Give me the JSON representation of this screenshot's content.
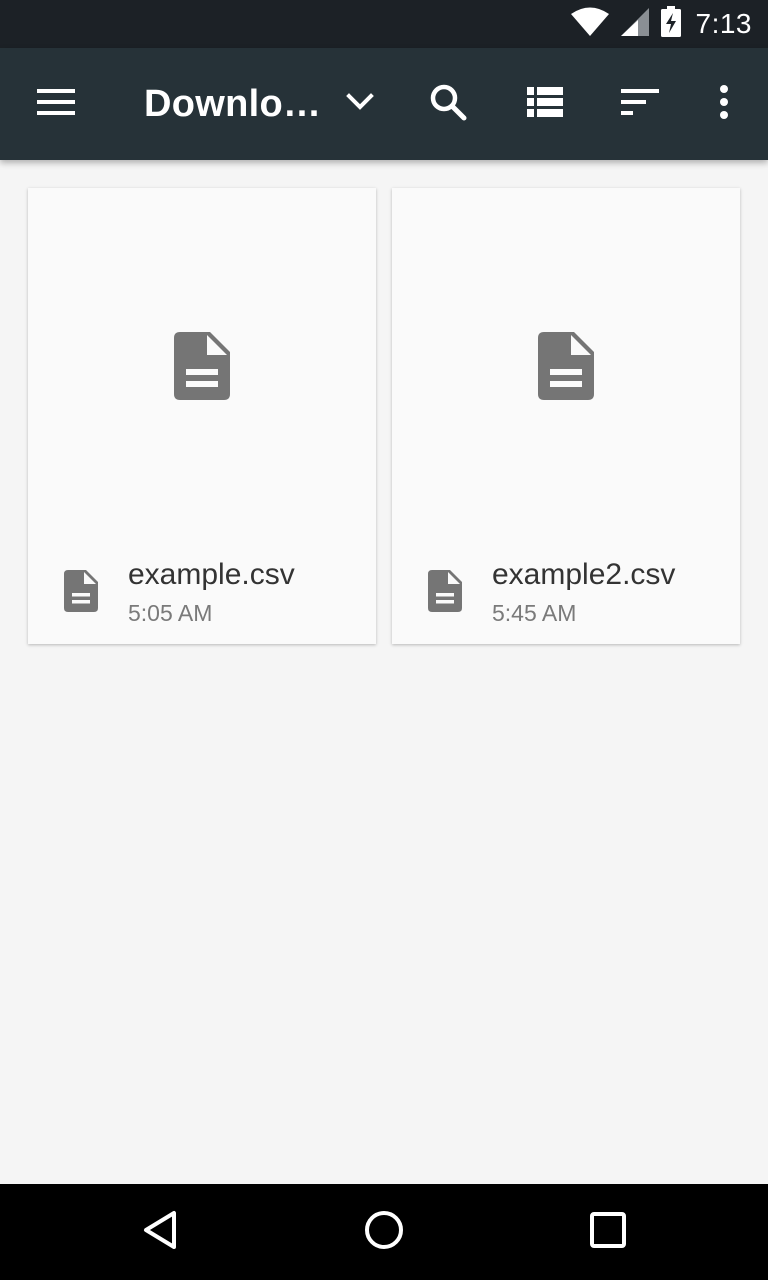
{
  "status_bar": {
    "time": "7:13",
    "icons": [
      "wifi-icon",
      "signal-icon",
      "battery-charging-icon"
    ]
  },
  "toolbar": {
    "title": "Downlo…",
    "icons": [
      "menu-icon",
      "chevron-down-icon",
      "search-icon",
      "list-view-icon",
      "sort-icon",
      "more-vert-icon"
    ]
  },
  "files": [
    {
      "name": "example.csv",
      "time": "5:05 AM",
      "icon": "document-icon"
    },
    {
      "name": "example2.csv",
      "time": "5:45 AM",
      "icon": "document-icon"
    }
  ],
  "nav_bar": {
    "icons": [
      "back-icon",
      "home-icon",
      "recents-icon"
    ]
  },
  "colors": {
    "status_bar": "#1c2126",
    "toolbar": "#263238",
    "background": "#f5f5f5",
    "card": "#fafafa",
    "doc_icon": "#757575",
    "file_name": "#333333",
    "file_time": "#7a7a7a"
  }
}
